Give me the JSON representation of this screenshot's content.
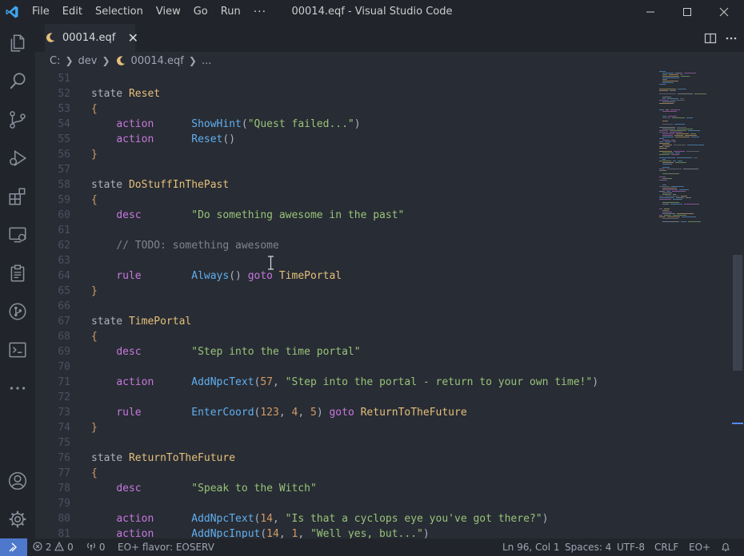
{
  "window": {
    "title": "00014.eqf - Visual Studio Code",
    "menu": [
      "File",
      "Edit",
      "Selection",
      "View",
      "Go",
      "Run"
    ],
    "menu_more": "···"
  },
  "tab": {
    "label": "00014.eqf",
    "close": "✕"
  },
  "breadcrumb": {
    "drive": "C:",
    "folder": "dev",
    "file": "00014.eqf",
    "more": "..."
  },
  "code": {
    "line_numbers": [
      "51",
      "52",
      "53",
      "54",
      "55",
      "56",
      "57",
      "58",
      "59",
      "60",
      "61",
      "62",
      "63",
      "64",
      "65",
      "66",
      "67",
      "68",
      "69",
      "70",
      "71",
      "72",
      "73",
      "74",
      "75",
      "76",
      "77",
      "78",
      "79",
      "80",
      "81"
    ],
    "state_kw": "state",
    "desc_kw": "desc",
    "action_kw": "action",
    "rule_kw": "rule",
    "goto_kw": "goto",
    "lbrace": "{",
    "rbrace": "}",
    "states": {
      "reset": "Reset",
      "past": "DoStuffInThePast",
      "portal": "TimePortal",
      "future": "ReturnToTheFuture"
    },
    "fn": {
      "show_hint": "ShowHint",
      "reset": "Reset",
      "always": "Always",
      "add_npc_text": "AddNpcText",
      "enter_coord": "EnterCoord",
      "add_npc_input": "AddNpcInput"
    },
    "str": {
      "quest_failed": "\"Quest failed...\"",
      "do_something": "\"Do something awesome in the past\"",
      "step_into": "\"Step into the time portal\"",
      "step_portal": "\"Step into the portal - return to your own time!\"",
      "speak_witch": "\"Speak to the Witch\"",
      "cyclops": "\"Is that a cyclops eye you've got there?\"",
      "well_yes": "\"Well yes, but...\""
    },
    "num": {
      "n57": "57",
      "n123": "123",
      "n4": "4",
      "n5": "5",
      "n14": "14",
      "n1": "1"
    },
    "comment": "// TODO: something awesome"
  },
  "statusbar": {
    "errors": "2",
    "warnings": "0",
    "radio": "0",
    "flavor": "EO+ flavor: EOSERV",
    "position": "Ln 96, Col 1",
    "spaces": "Spaces: 4",
    "encoding": "UTF-8",
    "eol": "CRLF",
    "language": "EO+"
  },
  "colors": {
    "keyword": "#c678dd",
    "type": "#e5c07b",
    "function": "#61afef",
    "string": "#98c379",
    "number": "#d19a66",
    "comment": "#7f848e",
    "accent": "#4d78cc"
  }
}
